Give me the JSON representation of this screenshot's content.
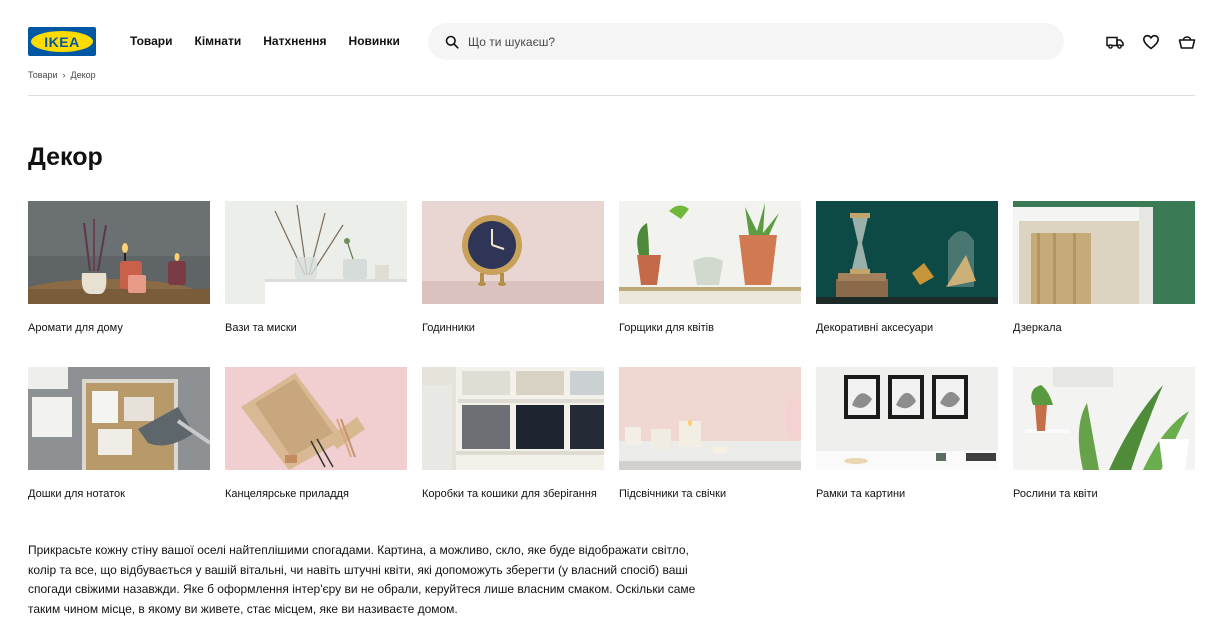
{
  "header": {
    "logo_text": "IKEA",
    "nav": [
      "Товари",
      "Кімнати",
      "Натхнення",
      "Новинки"
    ],
    "search_placeholder": "Що ти шукаєш?",
    "icons": [
      "truck-icon",
      "heart-icon",
      "bag-icon"
    ]
  },
  "breadcrumb": {
    "items": [
      "Товари",
      "Декор"
    ],
    "separator": "›"
  },
  "page_title": "Декор",
  "categories": [
    {
      "label": "Аромати для дому"
    },
    {
      "label": "Вази та миски"
    },
    {
      "label": "Годинники"
    },
    {
      "label": "Горщики для квітів"
    },
    {
      "label": "Декоративні аксесуари"
    },
    {
      "label": "Дзеркала"
    },
    {
      "label": "Дошки для нотаток"
    },
    {
      "label": "Канцелярське приладдя"
    },
    {
      "label": "Коробки та кошики для зберігання"
    },
    {
      "label": "Підсвічники та свічки"
    },
    {
      "label": "Рамки та картини"
    },
    {
      "label": "Рослини та квіти"
    }
  ],
  "description": "Прикрасьте кожну стіну вашої оселі найтеплішими спогадами. Картина, а можливо, скло, яке буде відображати світло, колір та все, що відбувається у вашій вітальні, чи навіть штучні квіти, які допоможуть зберегти (у власний спосіб) ваші спогади свіжими назавжди. Яке б оформлення інтер'єру ви не обрали, керуйтеся лише власним смаком. Оскільки саме таким чином місце, в якому ви живете, стає місцем, яке ви називаєте домом.",
  "colors": {
    "brand_blue": "#0058a3",
    "brand_yellow": "#ffdb00",
    "search_bg": "#f5f5f5"
  }
}
